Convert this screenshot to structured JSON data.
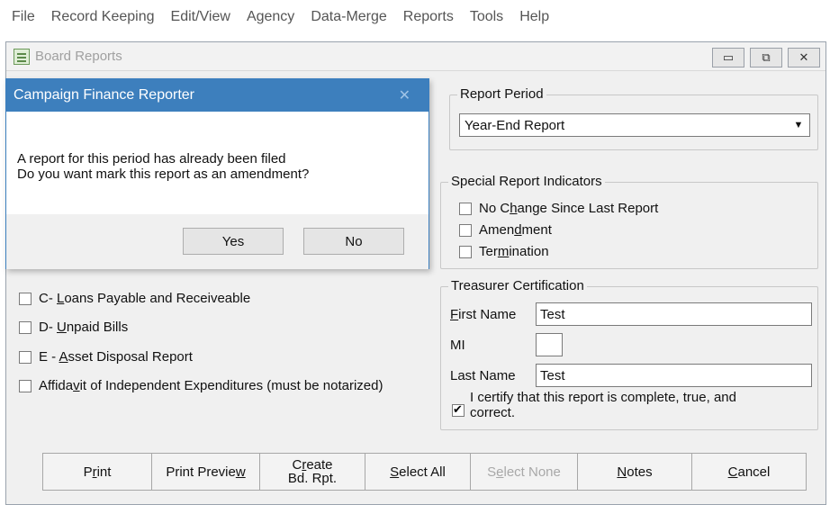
{
  "menu": [
    "File",
    "Record Keeping",
    "Edit/View",
    "Agency",
    "Data-Merge",
    "Reports",
    "Tools",
    "Help"
  ],
  "window": {
    "title": "Board Reports",
    "minimize_glyph": "▭",
    "maximize_glyph": "⧉",
    "close_glyph": "✕"
  },
  "report_period": {
    "label": "Report Period",
    "value": "Year-End Report",
    "arrow": "▼"
  },
  "special_indicators": {
    "label": "Special Report Indicators",
    "no_change": {
      "pre": "No C",
      "key": "h",
      "post": "ange Since Last Report",
      "checked": false
    },
    "amendment": {
      "pre": "Amen",
      "key": "d",
      "post": "ment",
      "checked": false
    },
    "termination": {
      "pre": "Ter",
      "key": "m",
      "post": "ination",
      "checked": false
    }
  },
  "schedules": {
    "c": {
      "pre": "C- ",
      "key": "L",
      "post": "oans Payable and Receiveable",
      "checked": false
    },
    "d": {
      "pre": "D- ",
      "key": "U",
      "post": "npaid Bills",
      "checked": false
    },
    "e": {
      "pre": "E - ",
      "key": "A",
      "post": "sset Disposal Report",
      "checked": false
    },
    "affidavit": {
      "pre": "Affida",
      "key": "v",
      "post": "it of Independent Expenditures (must be notarized)",
      "checked": false
    }
  },
  "treasurer": {
    "label": "Treasurer Certification",
    "first_name": {
      "key": "F",
      "rest": "irst Name",
      "value": "Test"
    },
    "mi": {
      "label": "MI",
      "value": ""
    },
    "last_name": {
      "label": "Last Name",
      "value": "Test"
    },
    "certify": {
      "text1": "I certify that this report is complete, true, and",
      "text2": "correct.",
      "checked": true
    }
  },
  "buttons": {
    "print": {
      "pre": "P",
      "key": "r",
      "post": "int"
    },
    "print_preview": {
      "pre": "Print Previe",
      "key": "w",
      "post": ""
    },
    "create": {
      "line1_pre": "C",
      "line1_key": "r",
      "line1_post": "eate",
      "line2": "Bd. Rpt."
    },
    "select_all": {
      "pre": "",
      "key": "S",
      "post": "elect All"
    },
    "select_none": {
      "pre": "S",
      "key": "e",
      "post": "lect None"
    },
    "notes": {
      "pre": "",
      "key": "N",
      "post": "otes"
    },
    "cancel": {
      "pre": "",
      "key": "C",
      "post": "ancel"
    }
  },
  "dialog": {
    "title": "Campaign Finance Reporter",
    "close_glyph": "✕",
    "line1": "A report for this period has already been filed",
    "line2": "Do you want mark this report as an amendment?",
    "yes": "Yes",
    "no": "No"
  }
}
